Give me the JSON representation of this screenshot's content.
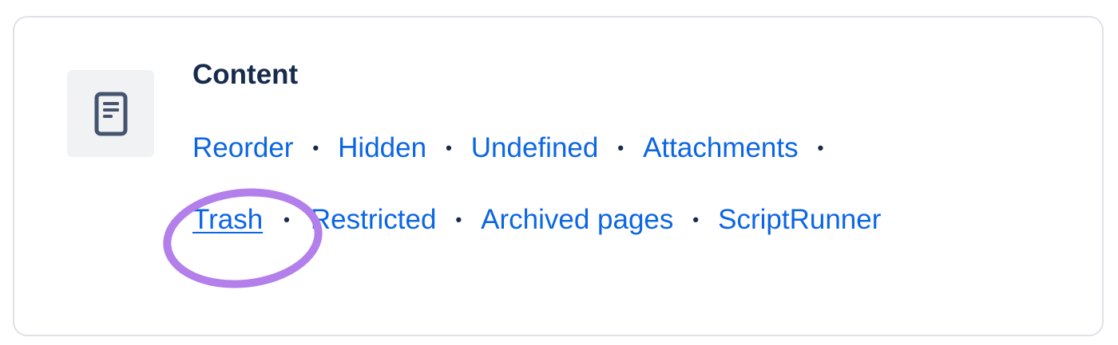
{
  "section": {
    "title": "Content",
    "icon": "document-icon"
  },
  "links": {
    "row1": [
      "Reorder",
      "Hidden",
      "Undefined",
      "Attachments"
    ],
    "row2": [
      "Trash",
      "Restricted",
      "Archived pages",
      "ScriptRunner"
    ]
  },
  "separator": "•",
  "colors": {
    "link": "#0c66e4",
    "title": "#172b4d",
    "highlight_ring": "#b37fea",
    "icon_tile_bg": "#f1f2f4"
  }
}
